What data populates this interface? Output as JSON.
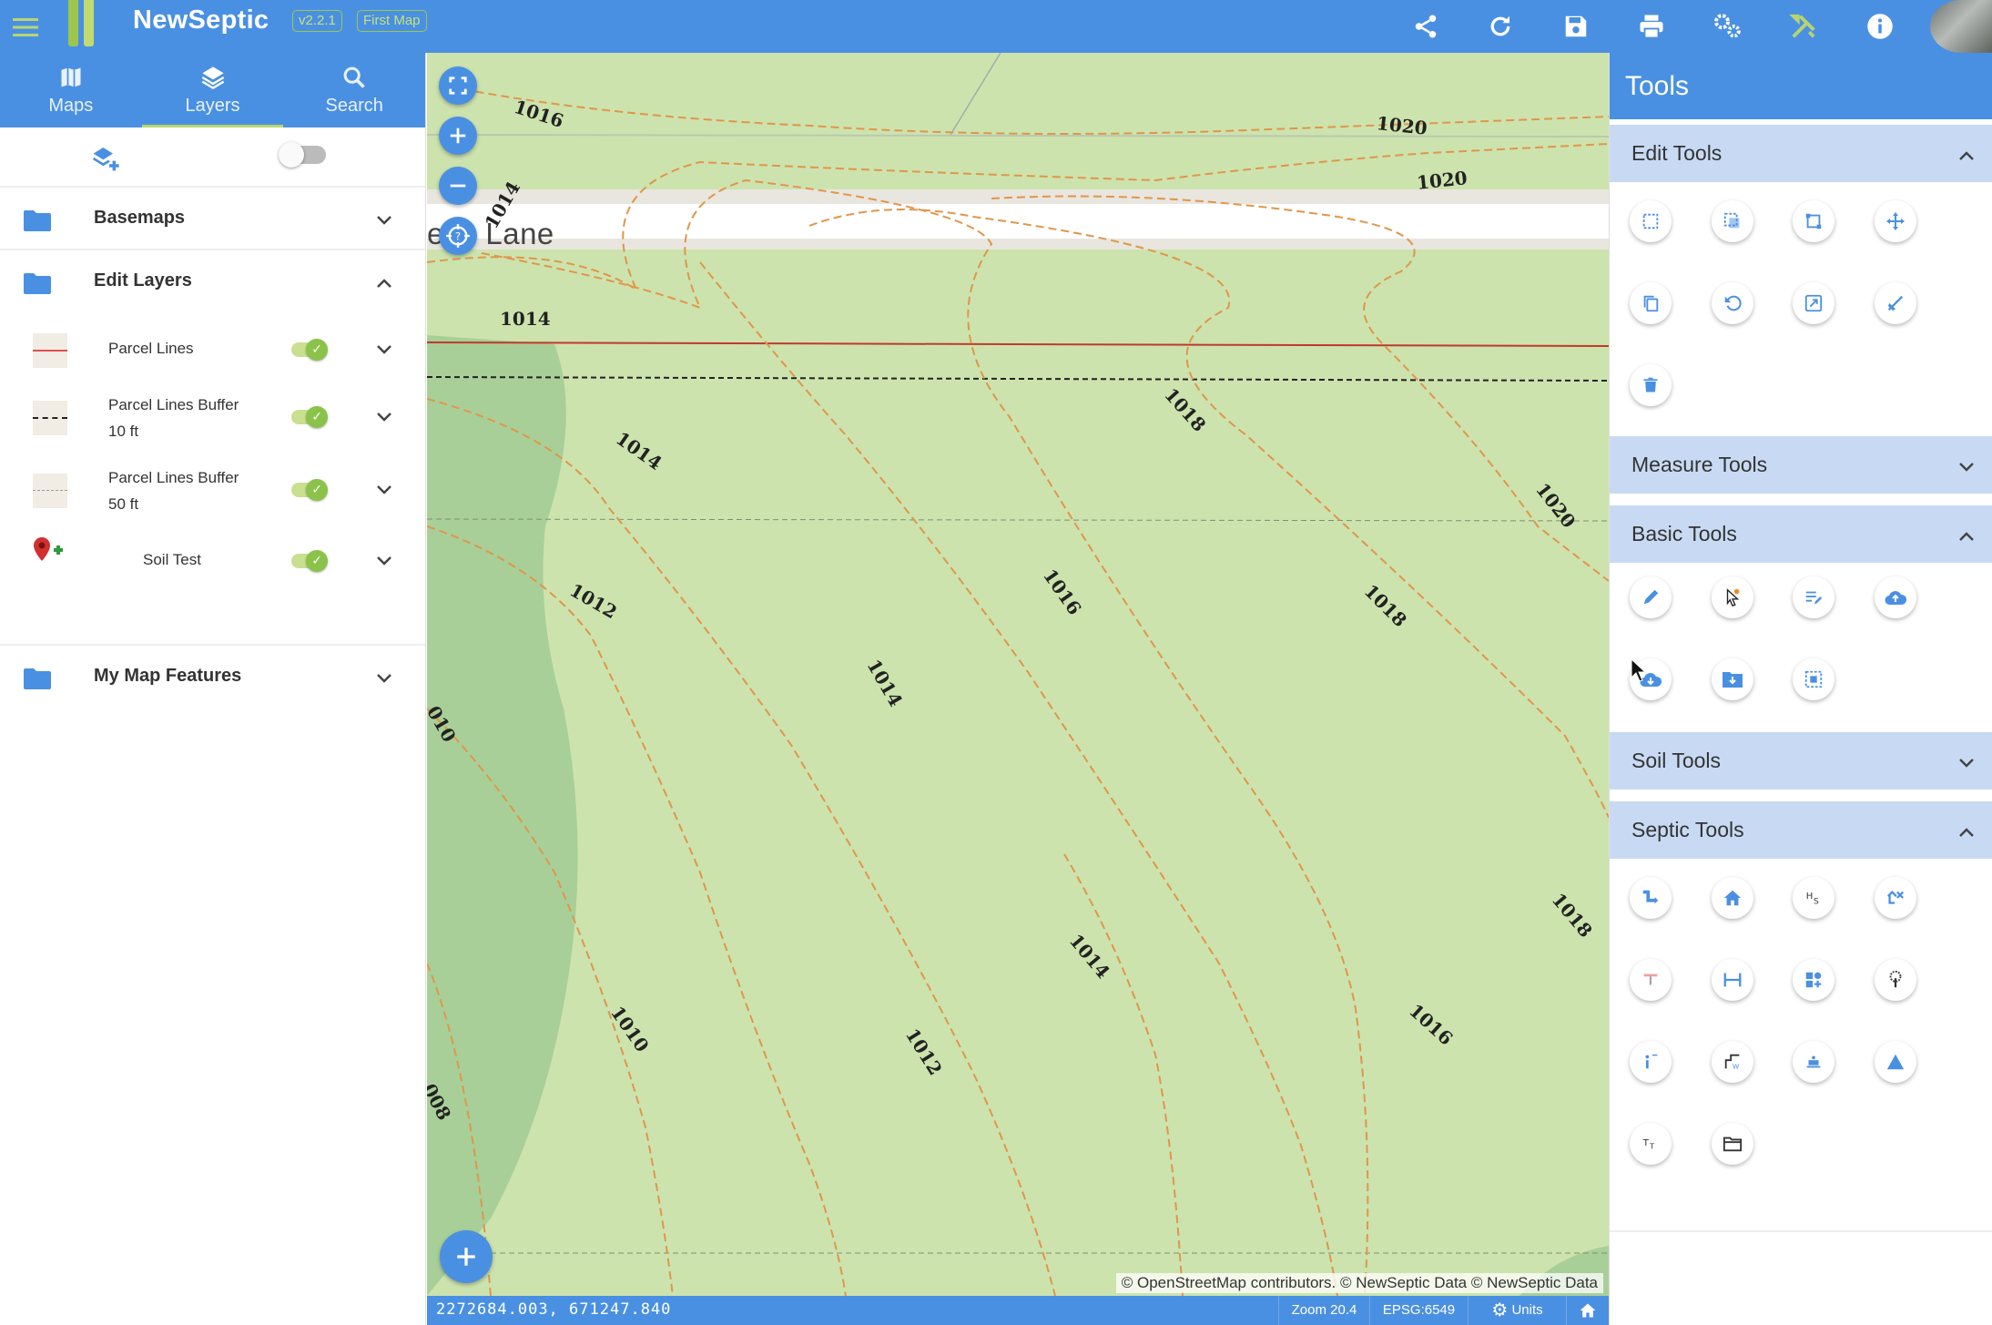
{
  "app": {
    "name": "NewSeptic",
    "version": "v2.2.1",
    "map_name": "First Map",
    "brand_color": "#4a90e2",
    "accent_color": "#9dc64d"
  },
  "toolbar": {
    "icons": [
      "share-icon",
      "refresh-icon",
      "save-icon",
      "print-icon",
      "settings-icon",
      "tools-icon",
      "info-icon"
    ]
  },
  "left_panel": {
    "tabs": [
      {
        "label": "Maps",
        "icon": "map-icon",
        "active": false
      },
      {
        "label": "Layers",
        "icon": "layers-icon",
        "active": true
      },
      {
        "label": "Search",
        "icon": "search-icon",
        "active": false
      }
    ],
    "groups": [
      {
        "title": "Basemaps",
        "expanded": false
      },
      {
        "title": "Edit Layers",
        "expanded": true
      },
      {
        "title": "My Map Features",
        "expanded": false
      }
    ],
    "layers": [
      {
        "line1": "Parcel Lines",
        "line2": "",
        "visible": true
      },
      {
        "line1": "Parcel Lines Buffer",
        "line2": "10 ft",
        "visible": true
      },
      {
        "line1": "Parcel Lines Buffer",
        "line2": "50 ft",
        "visible": true
      },
      {
        "line1": "Soil Test",
        "line2": "",
        "visible": true
      }
    ]
  },
  "map": {
    "street_label": "ees Lane",
    "contour_labels": [
      "1016",
      "1020",
      "1020",
      "1014",
      "1014",
      "1018",
      "1014",
      "1020",
      "1012",
      "1016",
      "1018",
      "1014",
      "010",
      "1014",
      "1018",
      "1010",
      "1012",
      "1016",
      "008"
    ],
    "attribution": "© OpenStreetMap contributors. © NewSeptic Data © NewSeptic Data"
  },
  "status": {
    "coordinates": "2272684.003, 671247.840",
    "zoom": "Zoom 20.4",
    "projection": "EPSG:6549",
    "units": "Units"
  },
  "tools_panel": {
    "title": "Tools",
    "sections": [
      {
        "title": "Edit Tools",
        "expanded": true
      },
      {
        "title": "Measure Tools",
        "expanded": false
      },
      {
        "title": "Basic Tools",
        "expanded": true
      },
      {
        "title": "Soil Tools",
        "expanded": false
      },
      {
        "title": "Septic Tools",
        "expanded": true
      }
    ]
  }
}
